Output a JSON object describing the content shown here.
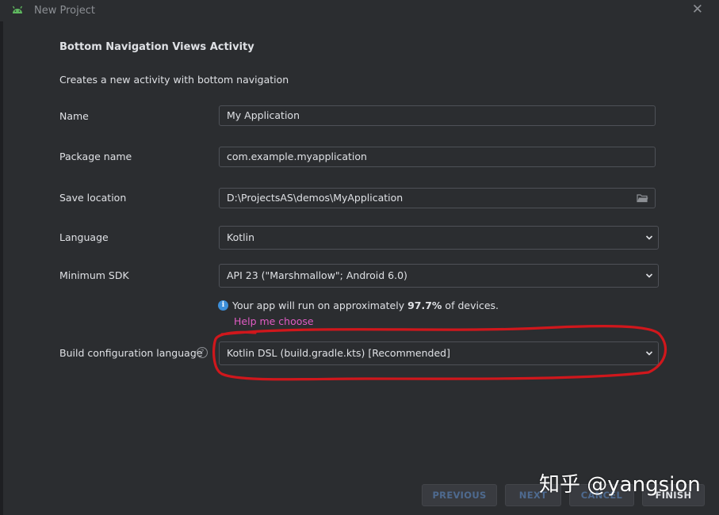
{
  "window": {
    "title": "New Project",
    "close_icon": "close-icon"
  },
  "template": {
    "heading": "Bottom Navigation Views Activity",
    "description": "Creates a new activity with bottom navigation"
  },
  "form": {
    "name": {
      "label": "Name",
      "value": "My Application"
    },
    "package": {
      "label": "Package name",
      "value": "com.example.myapplication"
    },
    "save_location": {
      "label": "Save location",
      "value": "D:\\ProjectsAS\\demos\\MyApplication",
      "icon": "folder-icon"
    },
    "language": {
      "label": "Language",
      "value": "Kotlin"
    },
    "min_sdk": {
      "label": "Minimum SDK",
      "value": "API 23 (\"Marshmallow\"; Android 6.0)"
    },
    "sdk_info": {
      "prefix": "Your app will run on approximately ",
      "percent": "97.7%",
      "suffix": " of devices."
    },
    "help_link": "Help me choose",
    "build_config": {
      "label": "Build configuration language",
      "value": "Kotlin DSL (build.gradle.kts) [Recommended]"
    }
  },
  "buttons": {
    "previous": "PREVIOUS",
    "next": "NEXT",
    "cancel": "CANCEL",
    "finish": "FINISH"
  },
  "watermark": "知乎 @yangsion",
  "colors": {
    "background": "#2b2d30",
    "link": "#e05cc4",
    "info": "#3d8fd9",
    "annotation": "#d0171c"
  }
}
